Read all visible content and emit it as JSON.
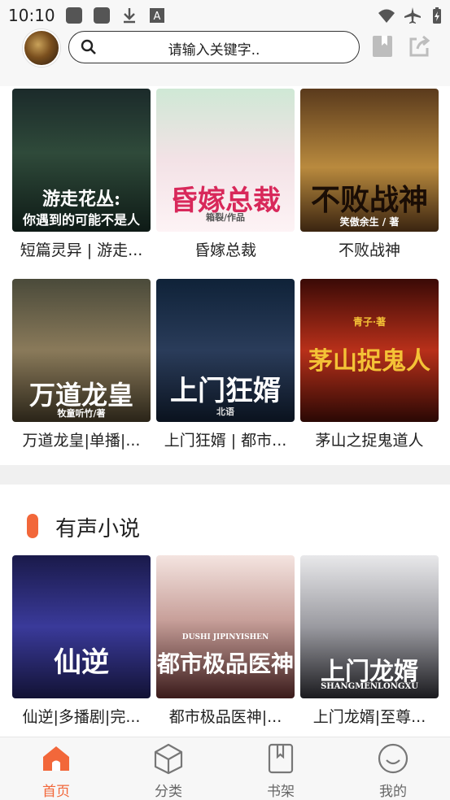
{
  "status_bar": {
    "time": "10:10"
  },
  "header": {
    "search_placeholder": "请输入关键字.."
  },
  "row1": [
    {
      "title": "短篇灵异 | 游走...",
      "cover_text": "游走花丛:",
      "cover_text2": "你遇到的可能不是人"
    },
    {
      "title": "昏嫁总裁",
      "cover_text": "昏嫁总裁",
      "cover_text2": "箱裂/作品"
    },
    {
      "title": "不败战神",
      "cover_text": "不败战神",
      "cover_text2": "笑傲余生 / 著"
    }
  ],
  "row2": [
    {
      "title": "万道龙皇|单播|...",
      "cover_text": "万道龙皇",
      "cover_text2": "牧童听竹/著"
    },
    {
      "title": "上门狂婿 | 都市...",
      "cover_text": "上门狂婿",
      "cover_text2": "北语"
    },
    {
      "title": "茅山之捉鬼道人",
      "cover_text": "茅山捉鬼人",
      "cover_text2": "青子·著"
    }
  ],
  "section2": {
    "heading": "有声小说",
    "items": [
      {
        "title": "仙逆|多播剧|完...",
        "cover_text": "仙逆"
      },
      {
        "title": "都市极品医神|...",
        "cover_text": "都市极品医神",
        "cover_text2": "DUSHI JIPINYISHEN"
      },
      {
        "title": "上门龙婿|至尊...",
        "cover_text": "上门龙婿",
        "cover_text2": "SHANGMENLONGXU"
      }
    ]
  },
  "nav": [
    {
      "label": "首页",
      "active": true
    },
    {
      "label": "分类",
      "active": false
    },
    {
      "label": "书架",
      "active": false
    },
    {
      "label": "我的",
      "active": false
    }
  ],
  "colors": {
    "accent": "#f2673a"
  }
}
